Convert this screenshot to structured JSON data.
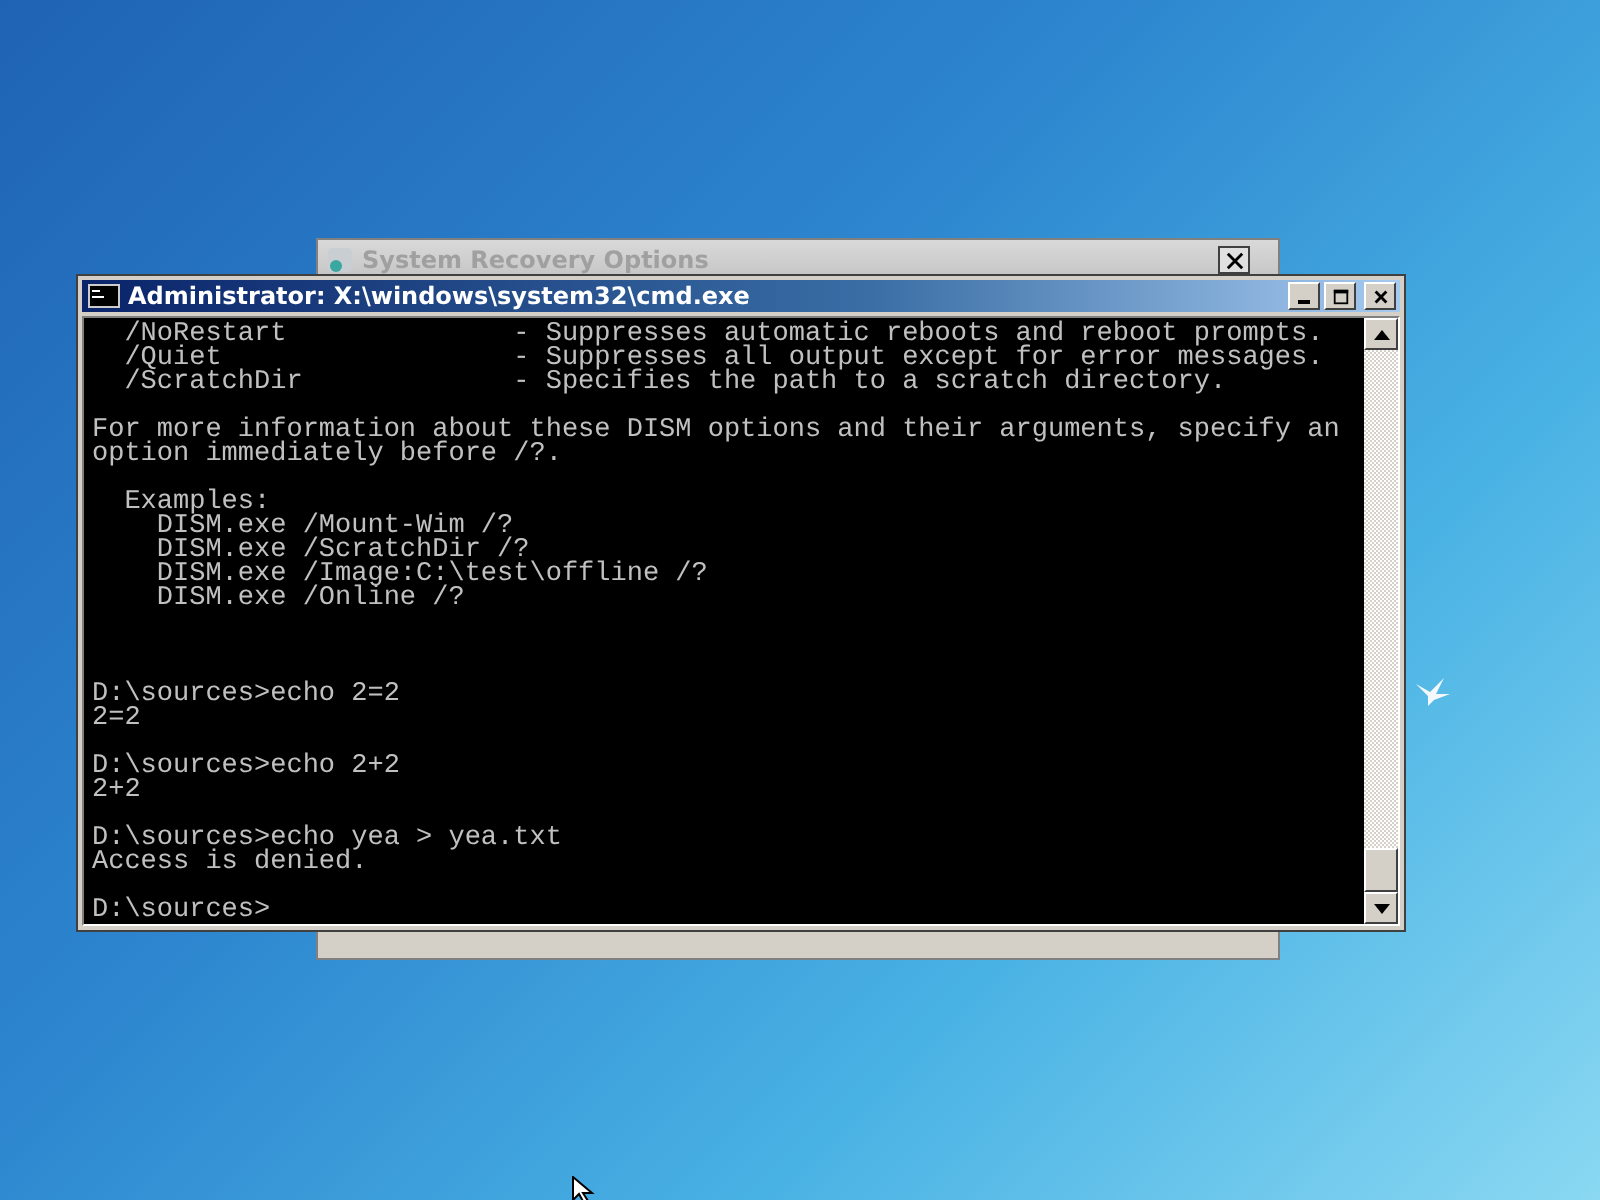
{
  "back_window": {
    "title": "System Recovery Options"
  },
  "console_window": {
    "title": "Administrator: X:\\windows\\system32\\cmd.exe"
  },
  "console": {
    "lines": [
      {
        "kind": "text",
        "text": "  /NoRestart              - Suppresses automatic reboots and reboot prompts."
      },
      {
        "kind": "text",
        "text": "  /Quiet                  - Suppresses all output except for error messages."
      },
      {
        "kind": "text",
        "text": "  /ScratchDir             - Specifies the path to a scratch directory."
      },
      {
        "kind": "blank"
      },
      {
        "kind": "text",
        "text": "For more information about these DISM options and their arguments, specify an"
      },
      {
        "kind": "text",
        "text": "option immediately before /?."
      },
      {
        "kind": "blank"
      },
      {
        "kind": "text",
        "text": "  Examples:"
      },
      {
        "kind": "text",
        "text": "    DISM.exe /Mount-Wim /?"
      },
      {
        "kind": "text",
        "text": "    DISM.exe /ScratchDir /?"
      },
      {
        "kind": "text",
        "text": "    DISM.exe /Image:C:\\test\\offline /?"
      },
      {
        "kind": "text",
        "text": "    DISM.exe /Online /?"
      },
      {
        "kind": "blank"
      },
      {
        "kind": "blank"
      },
      {
        "kind": "blank"
      },
      {
        "kind": "text",
        "text": "D:\\sources>echo 2=2"
      },
      {
        "kind": "text",
        "text": "2=2"
      },
      {
        "kind": "blank"
      },
      {
        "kind": "text",
        "text": "D:\\sources>echo 2+2"
      },
      {
        "kind": "text",
        "text": "2+2"
      },
      {
        "kind": "blank"
      },
      {
        "kind": "text",
        "text": "D:\\sources>echo yea > yea.txt"
      },
      {
        "kind": "text",
        "text": "Access is denied."
      },
      {
        "kind": "blank"
      },
      {
        "kind": "text",
        "text": "D:\\sources>"
      }
    ]
  }
}
